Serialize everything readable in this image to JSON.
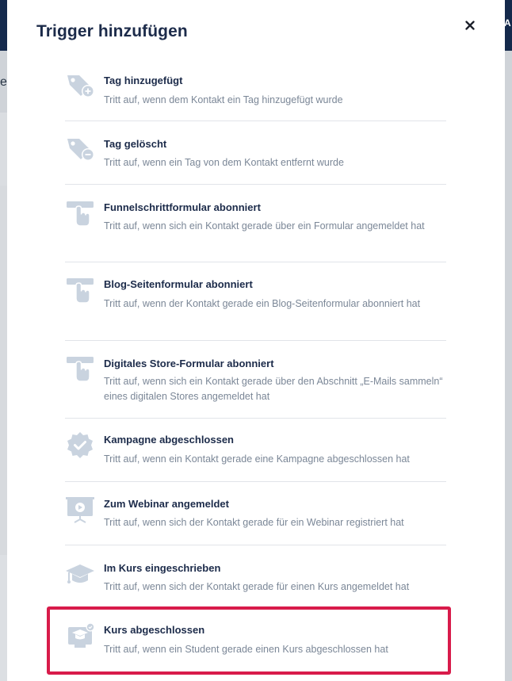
{
  "modal": {
    "title": "Trigger hinzufügen",
    "close_symbol": "×"
  },
  "background": {
    "left_letter": "e",
    "right_letter": "A"
  },
  "triggers": [
    {
      "icon": "tag-add-icon",
      "title": "Tag hinzugefügt",
      "description": "Tritt auf, wenn dem Kontakt ein Tag hinzugefügt wurde"
    },
    {
      "icon": "tag-remove-icon",
      "title": "Tag gelöscht",
      "description": "Tritt auf, wenn ein Tag von dem Kontakt entfernt wurde"
    },
    {
      "icon": "form-click-icon",
      "title": "Funnelschrittformular abonniert",
      "description": "Tritt auf, wenn sich ein Kontakt gerade über ein Formular angemeldet hat"
    },
    {
      "icon": "form-click-icon",
      "title": "Blog-Seitenformular abonniert",
      "description": "Tritt auf, wenn der Kontakt gerade ein Blog-Seitenformular abonniert hat"
    },
    {
      "icon": "form-click-icon",
      "title": "Digitales Store-Formular abonniert",
      "description": "Tritt auf, wenn sich ein Kontakt gerade über den Abschnitt „E-Mails sammeln“ eines digitalen Stores angemeldet hat"
    },
    {
      "icon": "badge-check-icon",
      "title": "Kampagne abgeschlossen",
      "description": "Tritt auf, wenn ein Kontakt gerade eine Kampagne abgeschlossen hat"
    },
    {
      "icon": "webinar-screen-icon",
      "title": "Zum Webinar angemeldet",
      "description": "Tritt auf, wenn sich der Kontakt gerade für ein Webinar registriert hat"
    },
    {
      "icon": "graduation-cap-icon",
      "title": "Im Kurs eingeschrieben",
      "description": "Tritt auf, wenn sich der Kontakt gerade für einen Kurs angemeldet hat"
    },
    {
      "icon": "course-complete-icon",
      "title": "Kurs abgeschlossen",
      "description": "Tritt auf, wenn ein Student gerade einen Kurs abgeschlossen hat"
    }
  ],
  "highlighted_trigger": "Kurs abgeschlossen",
  "colors": {
    "title": "#1c2b4a",
    "description": "#7b8797",
    "icon": "#c9d3df",
    "highlight": "#d81b4a",
    "topbar": "#152a4d"
  }
}
